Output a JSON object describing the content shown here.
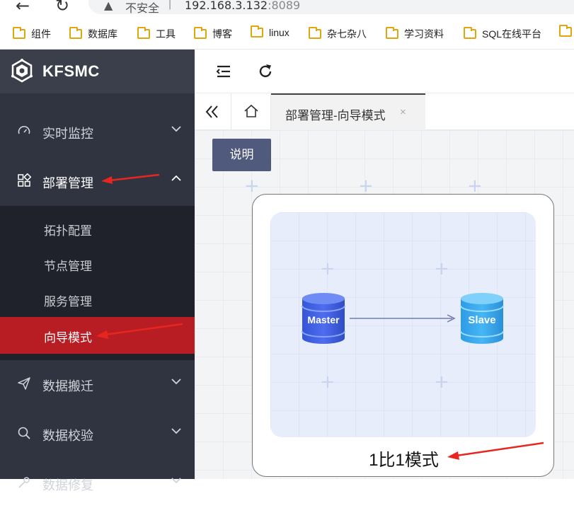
{
  "browser": {
    "back_icon": "arrow-left-icon",
    "reload_icon": "reload-icon",
    "security_text": "不安全",
    "url_host": "192.168.3.132",
    "url_port": ":8089"
  },
  "bookmarks": [
    {
      "label": "组件"
    },
    {
      "label": "数据库"
    },
    {
      "label": "工具"
    },
    {
      "label": "博客"
    },
    {
      "label": "linux"
    },
    {
      "label": "杂七杂八"
    },
    {
      "label": "学习资料"
    },
    {
      "label": "SQL在线平台"
    }
  ],
  "app": {
    "title": "KFSMC"
  },
  "sidebar": {
    "items": [
      {
        "label": "实时监控",
        "icon": "speedometer-icon",
        "expanded": false
      },
      {
        "label": "部署管理",
        "icon": "apps-icon",
        "expanded": true
      },
      {
        "label": "数据搬迁",
        "icon": "send-icon",
        "expanded": false
      },
      {
        "label": "数据校验",
        "icon": "search-icon",
        "expanded": false
      },
      {
        "label": "数据修复",
        "icon": "wrench-icon",
        "expanded": false
      }
    ],
    "submenu": [
      {
        "label": "拓扑配置"
      },
      {
        "label": "节点管理"
      },
      {
        "label": "服务管理"
      },
      {
        "label": "向导模式",
        "active": true
      }
    ]
  },
  "tabs": {
    "active_label": "部署管理-向导模式",
    "close_symbol": "×"
  },
  "main": {
    "help_button": "说明",
    "diagram": {
      "master_label": "Master",
      "slave_label": "Slave"
    },
    "mode_label": "1比1模式"
  },
  "colors": {
    "sidebar_bg": "#2f3440",
    "active_menu": "#b81d24",
    "help_button": "#505a7d",
    "annotation": "#e8261f"
  }
}
